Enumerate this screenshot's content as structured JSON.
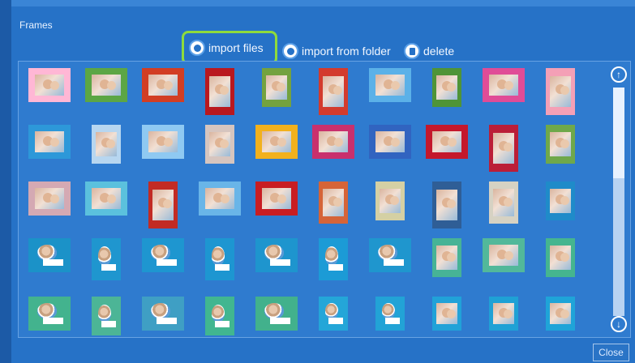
{
  "dialog": {
    "title": "Frames",
    "close_label": "Close"
  },
  "toolbar": {
    "import_files_label": "import files",
    "import_folder_label": "import from folder",
    "delete_label": "delete"
  },
  "colors": {
    "background": "#2672c7",
    "panel": "#2f7bcf",
    "highlight": "#8edb3c"
  },
  "icons": {
    "import_files": "gear-circle-icon",
    "import_folder": "gear-circle-icon",
    "delete": "trash-circle-icon",
    "scroll_up": "arrow-up-circle-icon",
    "scroll_down": "arrow-down-circle-icon"
  },
  "grid": {
    "rows": [
      [
        "#ffb7d5",
        "#5ca645",
        "#d23e24",
        "#b9181f",
        "#74a23f",
        "#d33b2d",
        "#5bb1e8",
        "#4f9437",
        "#e04c97",
        "#f4a0b6"
      ],
      [
        "#2d98d9",
        "#b7d6f0",
        "#8fc9f2",
        "#d6c5bf",
        "#f2b11d",
        "#c9306d",
        "#3164c0",
        "#c4182c",
        "#bb1e38",
        "#6fa84b"
      ],
      [
        "#d4a9b3",
        "#5bc1dd",
        "#c22b24",
        "#69b5e8",
        "#c81d22",
        "#d56438",
        "#d4d0a4",
        "#2f5e96",
        "#d6d2c3",
        "#1f8bc9"
      ],
      [
        "#1b92c8",
        "#1f96cf",
        "#1e96d0",
        "#1d96d1",
        "#1e95ce",
        "#1c9bd6",
        "#1f96ce",
        "#47b396",
        "#52b89a",
        "#45b58f"
      ],
      [
        "#43b38e",
        "#4cb596",
        "#3f9fc4",
        "#41b690",
        "#42b18c",
        "#24a6d8",
        "#22a3d6",
        "#21a2d8",
        "#1fa1d5",
        "#1fa4d8"
      ]
    ]
  }
}
